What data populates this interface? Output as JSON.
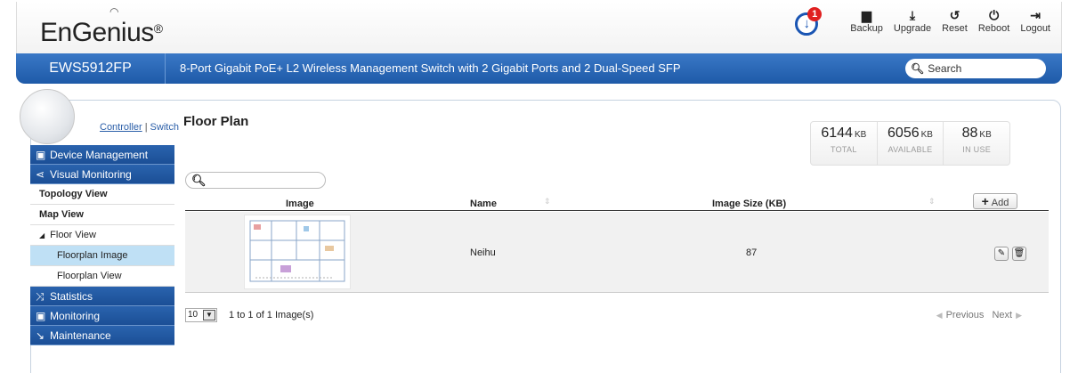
{
  "header": {
    "logo": "EnGenius",
    "logo_mark": "®",
    "notification_count": "1",
    "actions": [
      {
        "label": "Backup",
        "icon": "save-icon"
      },
      {
        "label": "Upgrade",
        "icon": "upload-icon"
      },
      {
        "label": "Reset",
        "icon": "reset-icon"
      },
      {
        "label": "Reboot",
        "icon": "power-icon"
      },
      {
        "label": "Logout",
        "icon": "logout-icon"
      }
    ],
    "model": "EWS5912FP",
    "description": "8-Port Gigabit PoE+ L2 Wireless Management Switch with 2 Gigabit Ports and 2 Dual-Speed SFP",
    "search_placeholder": "Search"
  },
  "sidebar": {
    "controller": "Controller",
    "switch": "Switch",
    "items": [
      {
        "label": "Device Management",
        "type": "main"
      },
      {
        "label": "Visual Monitoring",
        "type": "main"
      },
      {
        "label": "Topology View",
        "type": "sub"
      },
      {
        "label": "Map View",
        "type": "sub"
      },
      {
        "label": "Floor View",
        "type": "sub"
      },
      {
        "label": "Floorplan Image",
        "type": "subsub"
      },
      {
        "label": "Floorplan View",
        "type": "subsub"
      },
      {
        "label": "Statistics",
        "type": "main"
      },
      {
        "label": "Monitoring",
        "type": "main"
      },
      {
        "label": "Maintenance",
        "type": "main"
      }
    ]
  },
  "main": {
    "title": "Floor Plan",
    "stats": [
      {
        "value": "6144",
        "unit": "KB",
        "label": "TOTAL"
      },
      {
        "value": "6056",
        "unit": "KB",
        "label": "AVAILABLE"
      },
      {
        "value": "88",
        "unit": "KB",
        "label": "IN USE"
      }
    ],
    "table": {
      "columns": [
        "Image",
        "Name",
        "Image Size (KB)"
      ],
      "add_label": "Add",
      "rows": [
        {
          "name": "Neihu",
          "size": "87"
        }
      ]
    },
    "footer": {
      "per_page": "10",
      "range": "1 to 1 of 1 Image(s)",
      "previous": "Previous",
      "next": "Next"
    }
  }
}
